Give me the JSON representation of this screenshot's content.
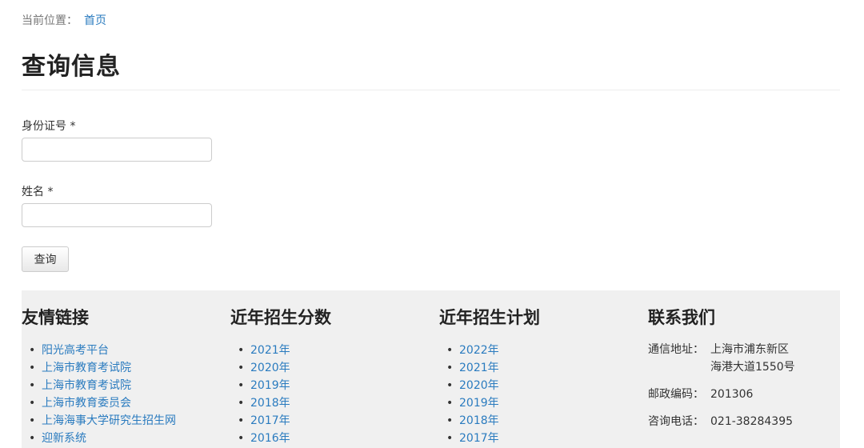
{
  "breadcrumb": {
    "prefix": "当前位置：",
    "home": "首页"
  },
  "page_title": "查询信息",
  "form": {
    "id_label": "身份证号 *",
    "id_value": "",
    "id_placeholder": "",
    "name_label": "姓名 *",
    "name_value": "",
    "name_placeholder": "",
    "submit_label": "查询"
  },
  "footer": {
    "links": {
      "title": "友情链接",
      "items": [
        "阳光高考平台",
        "上海市教育考试院",
        "上海市教育考试院",
        "上海市教育委员会",
        "上海海事大学研究生招生网",
        "迎新系统"
      ]
    },
    "scores": {
      "title": "近年招生分数",
      "items": [
        "2021年",
        "2020年",
        "2019年",
        "2018年",
        "2017年",
        "2016年"
      ]
    },
    "plans": {
      "title": "近年招生计划",
      "items": [
        "2022年",
        "2021年",
        "2020年",
        "2019年",
        "2018年",
        "2017年"
      ]
    },
    "contact": {
      "title": "联系我们",
      "address_label": "通信地址：",
      "address_line1": "上海市浦东新区",
      "address_line2": "海港大道1550号",
      "postcode_label": "邮政编码：",
      "postcode": "201306",
      "phone_label": "咨询电话：",
      "phone": "021-38284395"
    }
  },
  "colors": {
    "link": "#2a7bbf",
    "footer_bg": "#f0f0f0"
  }
}
